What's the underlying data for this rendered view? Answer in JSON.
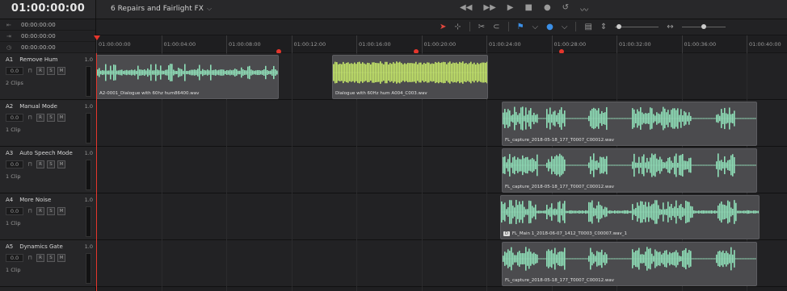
{
  "timecode": {
    "main": "01:00:00:00",
    "rows": [
      {
        "icon": "in-point-icon",
        "glyph": "⇤",
        "value": "00:00:00:00"
      },
      {
        "icon": "out-point-icon",
        "glyph": "⇥",
        "value": "00:00:00:00"
      },
      {
        "icon": "clock-icon",
        "glyph": "◷",
        "value": "00:00:00:00"
      }
    ]
  },
  "timeline": {
    "name": "6 Repairs and Fairlight FX"
  },
  "transport": [
    {
      "name": "rewind-icon",
      "glyph": "◀◀"
    },
    {
      "name": "fast-forward-icon",
      "glyph": "▶▶"
    },
    {
      "name": "play-icon",
      "glyph": "▶"
    },
    {
      "name": "stop-icon",
      "glyph": "■"
    },
    {
      "name": "record-icon",
      "glyph": "●"
    },
    {
      "name": "loop-icon",
      "glyph": "↺"
    },
    {
      "name": "automation-icon",
      "glyph": "〰"
    }
  ],
  "ruler": {
    "ticks": [
      "01:00:00:00",
      "01:00:04:00",
      "01:00:08:00",
      "01:00:12:00",
      "01:00:16:00",
      "01:00:20:00",
      "01:00:24:00",
      "01:00:28:00",
      "01:00:32:00",
      "01:00:36:00",
      "01:00:40:00"
    ]
  },
  "tracks": [
    {
      "id": "A1",
      "name": "Remove Hum",
      "volume": "1.0",
      "level": "0.0",
      "clips_count": "2 Clips"
    },
    {
      "id": "A2",
      "name": "Manual Mode",
      "volume": "1.0",
      "level": "0.0",
      "clips_count": "1 Clip"
    },
    {
      "id": "A3",
      "name": "Auto Speech Mode",
      "volume": "1.0",
      "level": "0.0",
      "clips_count": "1 Clip"
    },
    {
      "id": "A4",
      "name": "More Noise",
      "volume": "1.0",
      "level": "0.0",
      "clips_count": "1 Clip"
    },
    {
      "id": "A5",
      "name": "Dynamics Gate",
      "volume": "1.0",
      "level": "0.0",
      "clips_count": "1 Clip"
    }
  ],
  "track_buttons": {
    "r": "R",
    "s": "S",
    "m": "M"
  },
  "clips": [
    {
      "track": 0,
      "label": "A2-0001_Dialogue with 60hz hum86400.wav",
      "color": "#8fe0b8",
      "tag": ""
    },
    {
      "track": 0,
      "label": "Dialogue with 60Hz hum A004_C003.wav",
      "color": "#c6e86a",
      "tag": ""
    },
    {
      "track": 1,
      "label": "FL_capture_2018-05-18_177_T0007_C00012.wav",
      "color": "#8fe0b8",
      "tag": ""
    },
    {
      "track": 2,
      "label": "FL_capture_2018-05-18_177_T0007_C00012.wav",
      "color": "#8fe0b8",
      "tag": ""
    },
    {
      "track": 3,
      "label": "FL_Main 1_2018-06-07_1412_T0003_C00007.wav_1",
      "color": "#8fe0b8",
      "tag": "D"
    },
    {
      "track": 4,
      "label": "FL_capture_2018-05-18_177_T0007_C00012.wav",
      "color": "#8fe0b8",
      "tag": ""
    }
  ],
  "accent": {
    "playhead": "#e5362c",
    "flag": "#3b8fe6"
  }
}
